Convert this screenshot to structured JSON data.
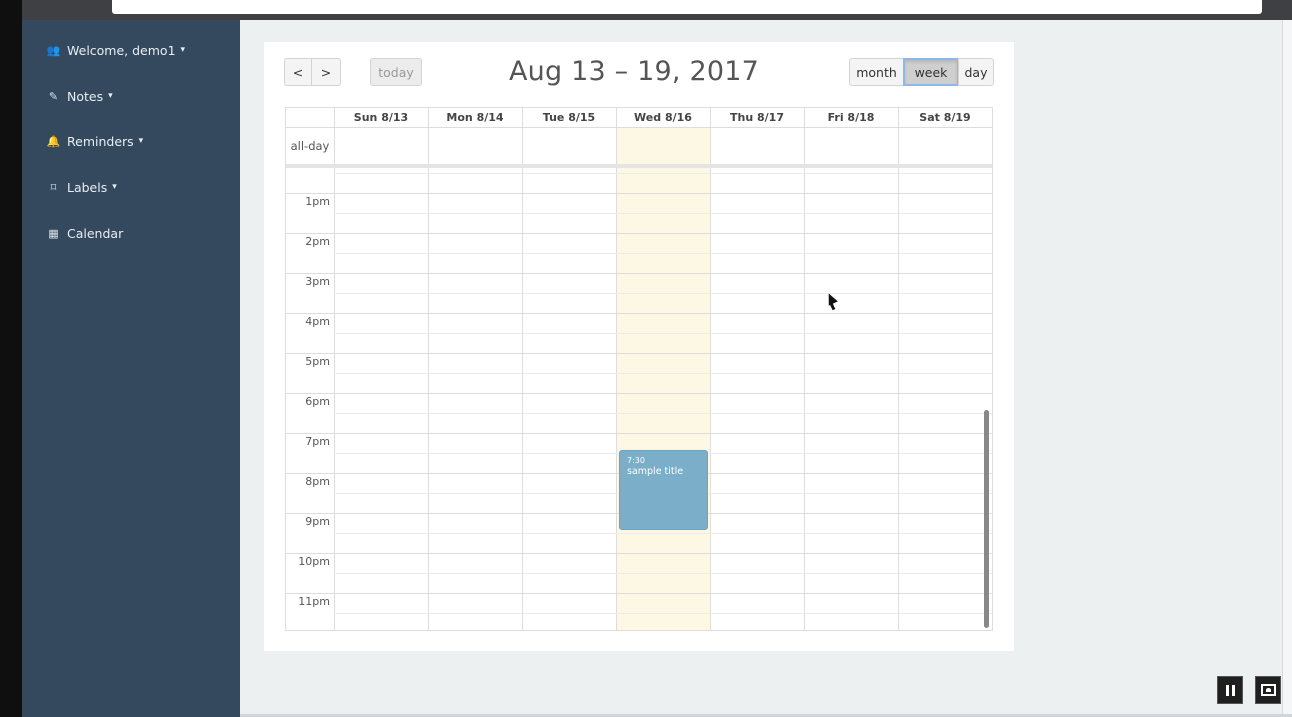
{
  "sidebar": {
    "items": [
      {
        "label": "Welcome, demo1",
        "icon": "users-icon",
        "glyph": "👥",
        "has_caret": true
      },
      {
        "label": "Notes",
        "icon": "edit-icon",
        "glyph": "✎",
        "has_caret": true
      },
      {
        "label": "Reminders",
        "icon": "bell-icon",
        "glyph": "🔔",
        "has_caret": true
      },
      {
        "label": "Labels",
        "icon": "bookmark-icon",
        "glyph": "⌑",
        "has_caret": true
      },
      {
        "label": "Calendar",
        "icon": "calendar-icon",
        "glyph": "▦",
        "has_caret": false
      }
    ],
    "caret": "▾"
  },
  "calendar": {
    "title": "Aug 13 – 19, 2017",
    "prev_label": "<",
    "next_label": ">",
    "today_label": "today",
    "views": {
      "month": "month",
      "week": "week",
      "day": "day"
    },
    "active_view": "week",
    "all_day_label": "all-day",
    "days": [
      "Sun 8/13",
      "Mon 8/14",
      "Tue 8/15",
      "Wed 8/16",
      "Thu 8/17",
      "Fri 8/18",
      "Sat 8/19"
    ],
    "today_day": "Wed 8/16",
    "hours": [
      "1pm",
      "2pm",
      "3pm",
      "4pm",
      "5pm",
      "6pm",
      "7pm",
      "8pm",
      "9pm",
      "10pm",
      "11pm"
    ],
    "event": {
      "time": "7:30",
      "title": "sample title",
      "day": "Wed 8/16"
    }
  },
  "colors": {
    "sidebar": "#34495e",
    "today_highlight": "#fcf8e3",
    "event": "#7aaec9"
  }
}
